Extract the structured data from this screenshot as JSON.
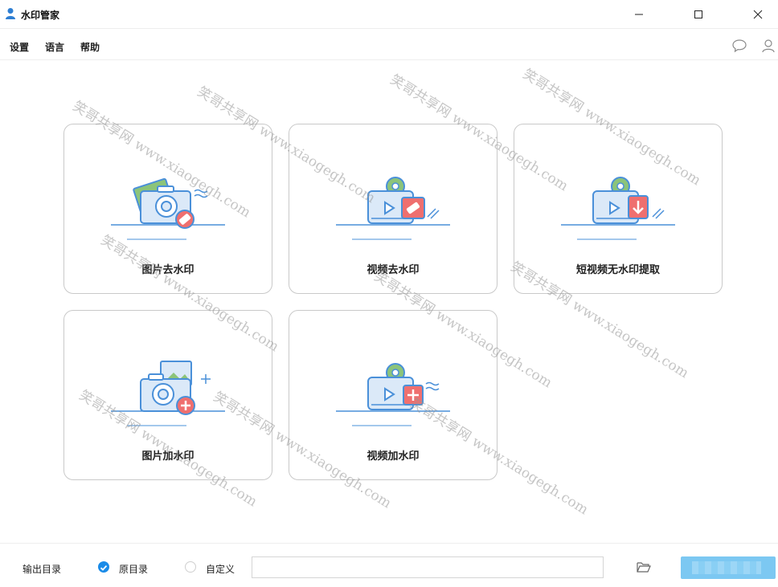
{
  "window": {
    "title": "水印管家",
    "minimize_glyph": "—",
    "maximize_glyph": "□",
    "close_glyph": "✕"
  },
  "menu": {
    "settings": "设置",
    "language": "语言",
    "help": "帮助"
  },
  "header_icons": [
    "chat-bubble-icon",
    "user-icon"
  ],
  "tools": [
    {
      "label": "图片去水印",
      "icon": "photo-remove-watermark-icon"
    },
    {
      "label": "视频去水印",
      "icon": "video-remove-watermark-icon"
    },
    {
      "label": "短视频无水印提取",
      "icon": "short-video-extract-icon"
    },
    {
      "label": "图片加水印",
      "icon": "photo-add-watermark-icon"
    },
    {
      "label": "视频加水印",
      "icon": "video-add-watermark-icon"
    }
  ],
  "output": {
    "label": "输出目录",
    "options": [
      {
        "label": "原目录",
        "checked": true
      },
      {
        "label": "自定义",
        "checked": false
      }
    ],
    "path_value": "",
    "folder_icon": "folder-icon"
  },
  "watermark_overlay": {
    "lines": [
      "笑哥共享网 www.xiaogegh.com",
      "笑哥共享网 www.xiaogegh.com",
      "笑哥共享网 www.xiaogegh.com",
      "笑哥共享网 www.xiaogegh.com",
      "笑哥共享网 www.xiaogegh.com",
      "笑哥共享网 www.xiaogegh.com",
      "笑哥共享网 www.xiaogegh.com",
      "笑哥共享网 www.xiaogegh.com",
      "笑哥共享网 www.xiaogegh.com",
      "笑哥共享网 www.xiaogegh.com"
    ]
  },
  "colors": {
    "accent_blue": "#1a8be8",
    "illus_blue": "#4a90d9",
    "illus_light": "#dbe9f8",
    "illus_red": "#ef6f6f",
    "illus_green": "#8cc47a",
    "start_button": "#7cc8f2"
  }
}
